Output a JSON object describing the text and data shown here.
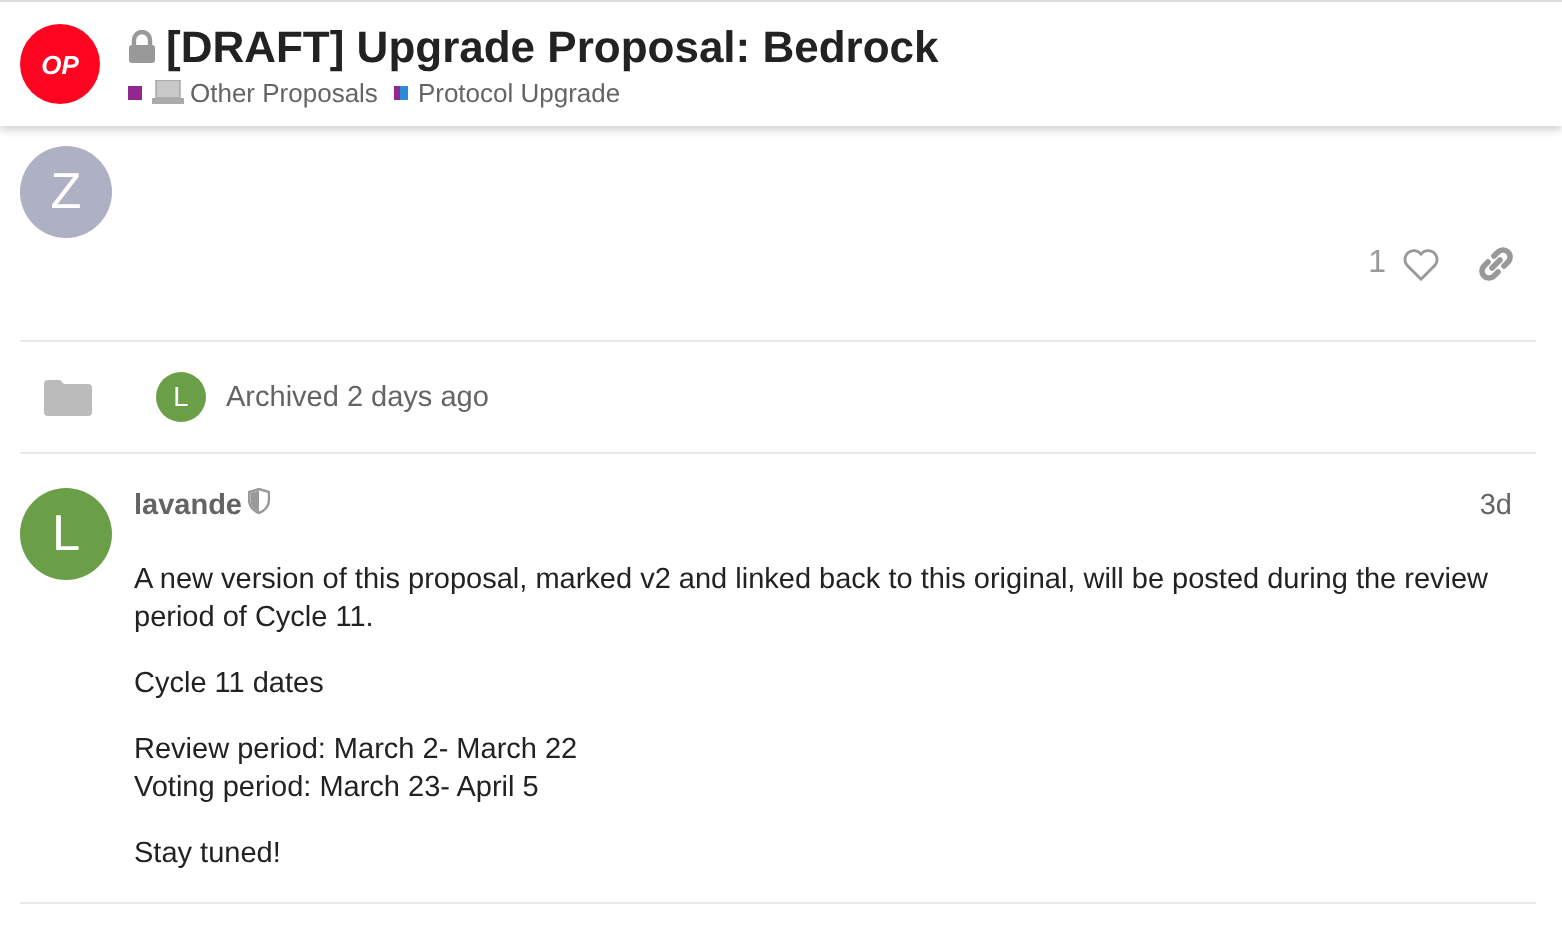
{
  "header": {
    "logo": "OP",
    "locked": true,
    "title": "[DRAFT] Upgrade Proposal: Bedrock",
    "categories": [
      {
        "name": "Other Proposals",
        "swatch": [
          {
            "color": "#92278f"
          }
        ],
        "emoji": true
      },
      {
        "name": "Protocol Upgrade",
        "swatch": [
          {
            "color": "#92278f"
          },
          {
            "color": "#2a8cd6"
          }
        ],
        "emoji": false
      }
    ]
  },
  "posts": [
    {
      "kind": "post",
      "avatar": "Z",
      "color": "#aeb0c4",
      "likes": "1",
      "liked": false
    },
    {
      "kind": "action",
      "avatar": "L",
      "color": "#6a9f48",
      "text": "Archived 2 days ago"
    },
    {
      "kind": "reply",
      "avatar": "L",
      "color": "#6a9f48",
      "username": "lavande",
      "moderator": true,
      "date": "3d",
      "paragraphs": [
        "A new version of this proposal, marked v2 and linked back to this original, will be posted during the review period of Cycle 11.",
        "Cycle 11 dates",
        [
          "Review period: March 2- March 22",
          "Voting period: March 23- April 5"
        ],
        "Stay tuned!"
      ]
    }
  ]
}
